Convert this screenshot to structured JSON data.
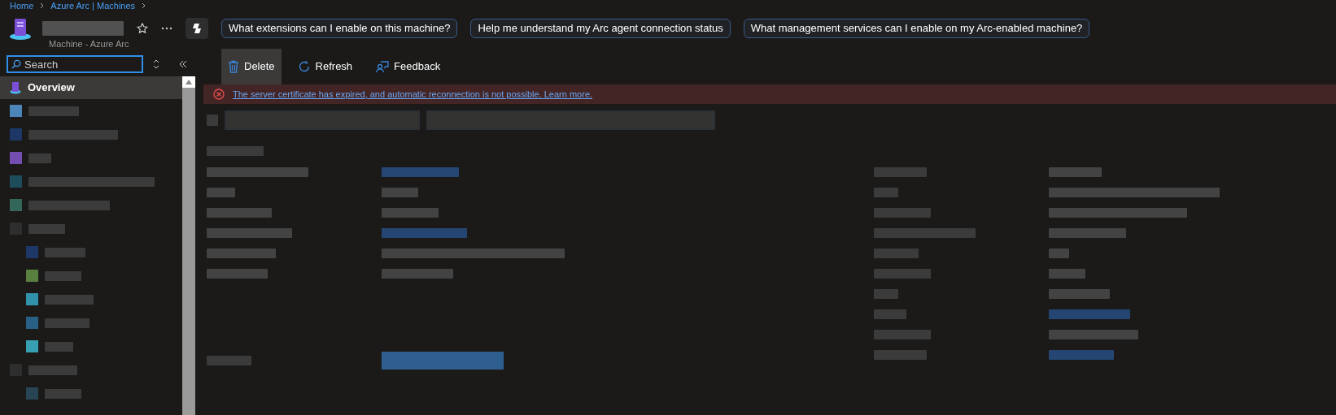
{
  "breadcrumb": [
    "Home",
    "Azure Arc | Machines"
  ],
  "header": {
    "subtitle": "Machine - Azure Arc",
    "prompts": [
      "What extensions can I enable on this machine?",
      "Help me understand my Arc agent connection status",
      "What management services can I enable on my Arc-enabled machine?"
    ]
  },
  "sidebar": {
    "search": {
      "placeholder": "Search"
    },
    "items": [
      {
        "label": "Overview",
        "selected": true
      }
    ]
  },
  "toolbar": [
    {
      "kind": "delete",
      "label": "Delete",
      "hovered": true
    },
    {
      "kind": "refresh",
      "label": "Refresh",
      "hovered": false
    },
    {
      "kind": "feedback",
      "label": "Feedback",
      "hovered": false
    }
  ],
  "alert": {
    "message": "The server certificate has expired, and automatic reconnection is not possible. Learn more."
  }
}
